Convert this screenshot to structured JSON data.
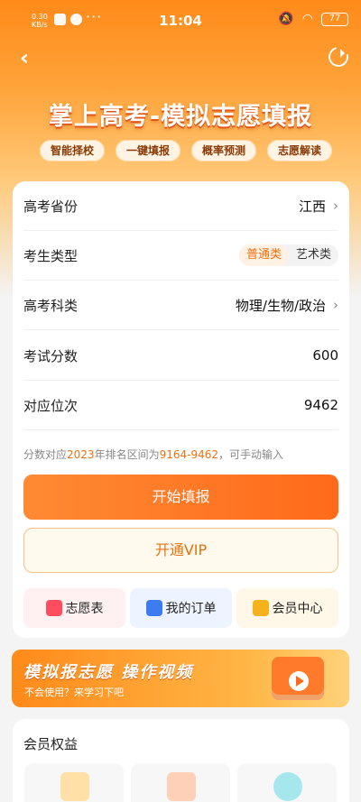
{
  "status_bar": {
    "time": "11:04",
    "kbs": "0.30",
    "kbs_unit": "KB/s",
    "dots": "···",
    "battery": "77"
  },
  "header": {
    "title": "掌上高考-模拟志愿填报",
    "back_icon": "chevron-left-icon",
    "refresh_icon": "refresh-icon"
  },
  "chips": [
    "智能择校",
    "一键填报",
    "概率预测",
    "志愿解读"
  ],
  "form": {
    "province": {
      "label": "高考省份",
      "value": "江西"
    },
    "student_type": {
      "label": "考生类型",
      "options": [
        "普通类",
        "艺术类"
      ],
      "selected": "普通类"
    },
    "subjects": {
      "label": "高考科类",
      "value": "物理/生物/政治"
    },
    "score": {
      "label": "考试分数",
      "value": "600"
    },
    "rank": {
      "label": "对应位次",
      "value": "9462"
    },
    "note": {
      "prefix": "分数对应",
      "year": "2023",
      "middle": "年排名区间为",
      "range": "9164-9462",
      "suffix": "，可手动输入"
    }
  },
  "buttons": {
    "start": "开始填报",
    "vip": "开通VIP"
  },
  "shortcuts": [
    {
      "label": "志愿表",
      "icon": "list-icon",
      "color": "#ff4d5e"
    },
    {
      "label": "我的订单",
      "icon": "order-icon",
      "color": "#3d7bf0"
    },
    {
      "label": "会员中心",
      "icon": "crown-icon",
      "color": "#f5b21b"
    }
  ],
  "banner": {
    "title": "模拟报志愿  操作视频",
    "subtitle": "不会使用？来学习下吧"
  },
  "benefits": {
    "title": "会员权益"
  },
  "colors": {
    "accent": "#ff7a1a",
    "accent_text": "#f07010"
  }
}
